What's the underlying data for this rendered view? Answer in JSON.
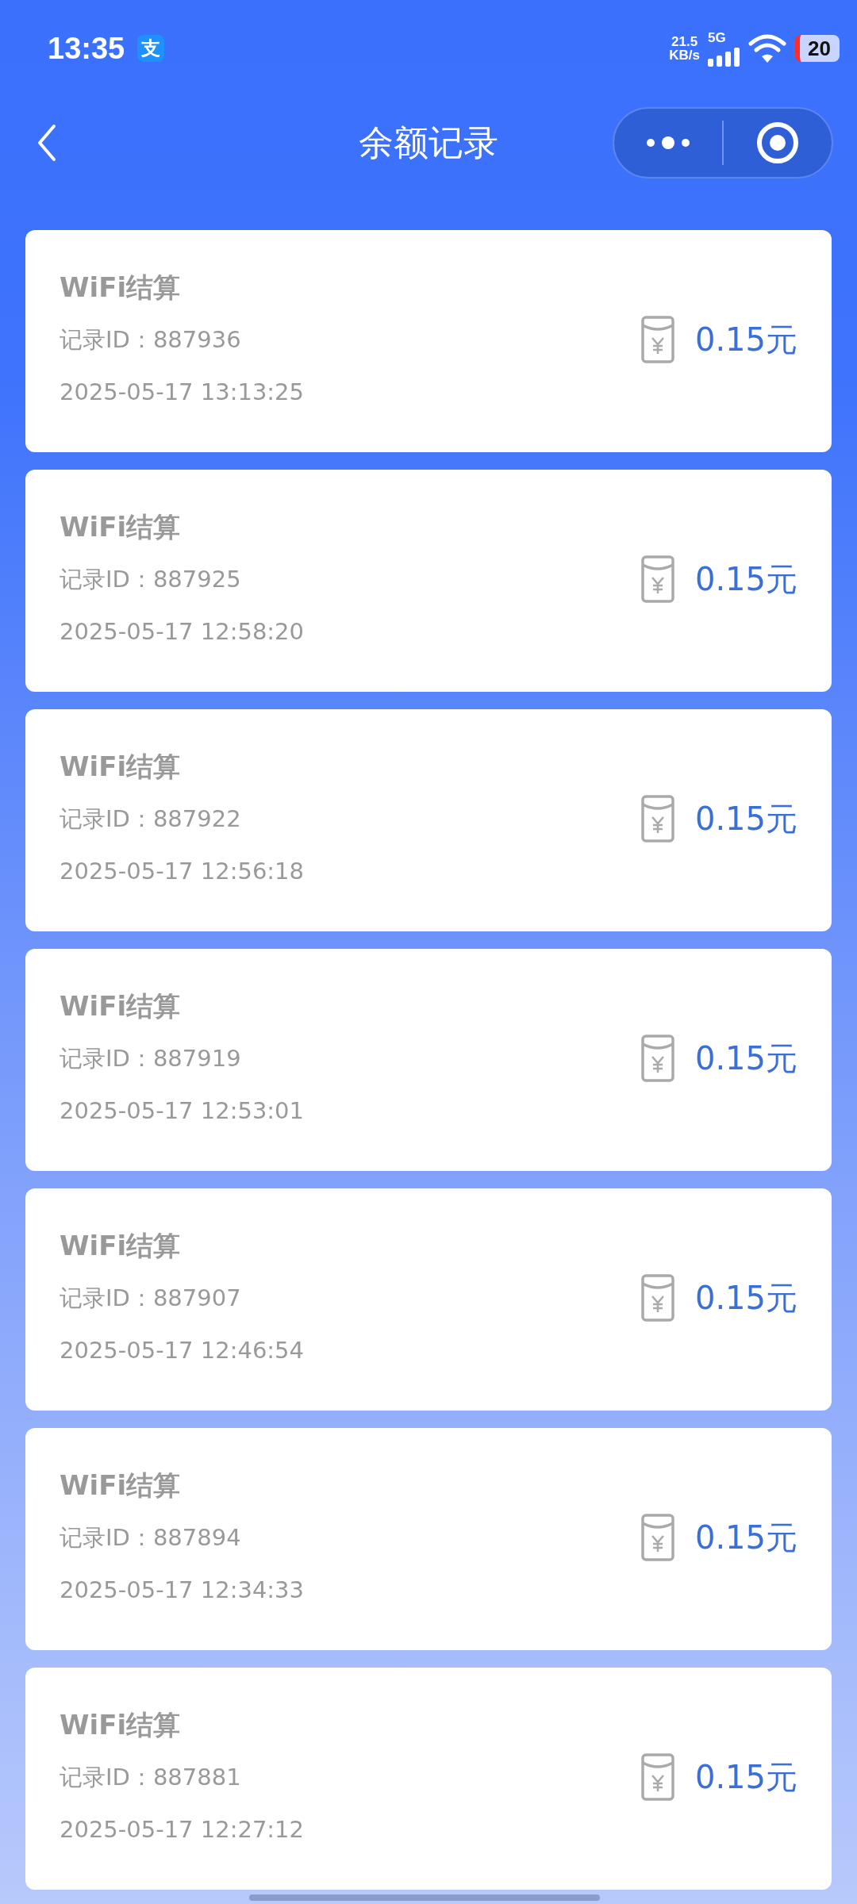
{
  "status_bar": {
    "time": "13:35",
    "app_badge": "支",
    "speed_value": "21.5",
    "speed_unit": "KB/s",
    "network": "5G",
    "battery": "20"
  },
  "header": {
    "title": "余额记录"
  },
  "records": [
    {
      "title": "WiFi结算",
      "record_id": "记录ID：887936",
      "time": "2025-05-17 13:13:25",
      "amount": "0.15元"
    },
    {
      "title": "WiFi结算",
      "record_id": "记录ID：887925",
      "time": "2025-05-17 12:58:20",
      "amount": "0.15元"
    },
    {
      "title": "WiFi结算",
      "record_id": "记录ID：887922",
      "time": "2025-05-17 12:56:18",
      "amount": "0.15元"
    },
    {
      "title": "WiFi结算",
      "record_id": "记录ID：887919",
      "time": "2025-05-17 12:53:01",
      "amount": "0.15元"
    },
    {
      "title": "WiFi结算",
      "record_id": "记录ID：887907",
      "time": "2025-05-17 12:46:54",
      "amount": "0.15元"
    },
    {
      "title": "WiFi结算",
      "record_id": "记录ID：887894",
      "time": "2025-05-17 12:34:33",
      "amount": "0.15元"
    },
    {
      "title": "WiFi结算",
      "record_id": "记录ID：887881",
      "time": "2025-05-17 12:27:12",
      "amount": "0.15元"
    }
  ]
}
